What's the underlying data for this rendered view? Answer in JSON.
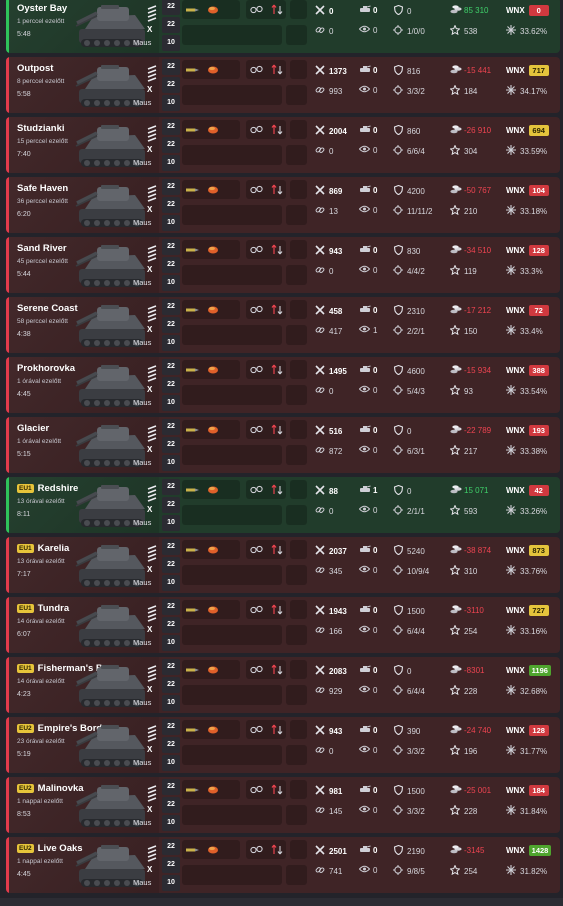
{
  "tank": {
    "name": "Maus",
    "x_label": "X"
  },
  "tiers": [
    "22",
    "22",
    "10"
  ],
  "colors": {
    "win_bg": "#213c2b",
    "loss_bg": "#3f2426",
    "win_accent": "#2fc25b",
    "loss_accent": "#e23b4c",
    "wnx_red": "#d0393f",
    "wnx_yellow": "#e4c43c",
    "wnx_green": "#4fa52e"
  },
  "icons": {
    "damage": "crossed-swords-icon",
    "frags": "tank-kill-icon",
    "block": "shield-icon",
    "assist": "link-icon",
    "spot": "eye-icon",
    "shots": "crosshair-icon",
    "credits": "coins-icon",
    "xp": "star-icon",
    "wn": "sparkle-icon"
  },
  "battles": [
    {
      "map": "Oyster Bay",
      "region": "",
      "ago": "1 perccel ezelőtt",
      "duration": "5:48",
      "result": "win",
      "damage": "0",
      "frags": "0",
      "blocked": "0",
      "assist": "0",
      "spotted": "0",
      "shots": "1/0/0",
      "credits": "85 310",
      "xp": "538",
      "wnx": "0",
      "wnx_color": "red",
      "wn_pct": "33.62%"
    },
    {
      "map": "Outpost",
      "region": "",
      "ago": "8 perccel ezelőtt",
      "duration": "5:58",
      "result": "loss",
      "damage": "1373",
      "frags": "0",
      "blocked": "816",
      "assist": "993",
      "spotted": "0",
      "shots": "3/3/2",
      "credits": "-15 441",
      "xp": "184",
      "wnx": "717",
      "wnx_color": "yellow",
      "wn_pct": "34.17%"
    },
    {
      "map": "Studzianki",
      "region": "",
      "ago": "15 perccel ezelőtt",
      "duration": "7:40",
      "result": "loss",
      "damage": "2004",
      "frags": "0",
      "blocked": "860",
      "assist": "0",
      "spotted": "0",
      "shots": "6/6/4",
      "credits": "-26 910",
      "xp": "304",
      "wnx": "694",
      "wnx_color": "yellow",
      "wn_pct": "33.59%"
    },
    {
      "map": "Safe Haven",
      "region": "",
      "ago": "36 perccel ezelőtt",
      "duration": "6:20",
      "result": "loss",
      "damage": "869",
      "frags": "0",
      "blocked": "4200",
      "assist": "13",
      "spotted": "0",
      "shots": "11/11/2",
      "credits": "-50 767",
      "xp": "210",
      "wnx": "104",
      "wnx_color": "red",
      "wn_pct": "33.18%"
    },
    {
      "map": "Sand River",
      "region": "",
      "ago": "45 perccel ezelőtt",
      "duration": "5:44",
      "result": "loss",
      "damage": "943",
      "frags": "0",
      "blocked": "830",
      "assist": "0",
      "spotted": "0",
      "shots": "4/4/2",
      "credits": "-34 510",
      "xp": "119",
      "wnx": "128",
      "wnx_color": "red",
      "wn_pct": "33.3%"
    },
    {
      "map": "Serene Coast",
      "region": "",
      "ago": "58 perccel ezelőtt",
      "duration": "4:38",
      "result": "loss",
      "damage": "458",
      "frags": "0",
      "blocked": "2310",
      "assist": "417",
      "spotted": "1",
      "shots": "2/2/1",
      "credits": "-17 212",
      "xp": "150",
      "wnx": "72",
      "wnx_color": "red",
      "wn_pct": "33.4%"
    },
    {
      "map": "Prokhorovka",
      "region": "",
      "ago": "1 órával ezelőtt",
      "duration": "4:45",
      "result": "loss",
      "damage": "1495",
      "frags": "0",
      "blocked": "4600",
      "assist": "0",
      "spotted": "0",
      "shots": "5/4/3",
      "credits": "-15 934",
      "xp": "93",
      "wnx": "388",
      "wnx_color": "red",
      "wn_pct": "33.54%"
    },
    {
      "map": "Glacier",
      "region": "",
      "ago": "1 órával ezelőtt",
      "duration": "5:15",
      "result": "loss",
      "damage": "516",
      "frags": "0",
      "blocked": "0",
      "assist": "872",
      "spotted": "0",
      "shots": "6/3/1",
      "credits": "-22 789",
      "xp": "217",
      "wnx": "193",
      "wnx_color": "red",
      "wn_pct": "33.38%"
    },
    {
      "map": "Redshire",
      "region": "EU1",
      "ago": "13 órával ezelőtt",
      "duration": "8:11",
      "result": "win",
      "damage": "88",
      "frags": "1",
      "blocked": "0",
      "assist": "0",
      "spotted": "0",
      "shots": "2/1/1",
      "credits": "15 071",
      "xp": "593",
      "wnx": "42",
      "wnx_color": "red",
      "wn_pct": "33.26%"
    },
    {
      "map": "Karelia",
      "region": "EU1",
      "ago": "13 órával ezelőtt",
      "duration": "7:17",
      "result": "loss",
      "damage": "2037",
      "frags": "0",
      "blocked": "5240",
      "assist": "345",
      "spotted": "0",
      "shots": "10/9/4",
      "credits": "-38 874",
      "xp": "310",
      "wnx": "873",
      "wnx_color": "yellow",
      "wn_pct": "33.76%"
    },
    {
      "map": "Tundra",
      "region": "EU1",
      "ago": "14 órával ezelőtt",
      "duration": "6:07",
      "result": "loss",
      "damage": "1943",
      "frags": "0",
      "blocked": "1500",
      "assist": "166",
      "spotted": "0",
      "shots": "6/4/4",
      "credits": "-3110",
      "xp": "254",
      "wnx": "727",
      "wnx_color": "yellow",
      "wn_pct": "33.16%"
    },
    {
      "map": "Fisherman's Bay",
      "region": "EU1",
      "ago": "14 órával ezelőtt",
      "duration": "4:23",
      "result": "loss",
      "damage": "2083",
      "frags": "0",
      "blocked": "0",
      "assist": "929",
      "spotted": "0",
      "shots": "6/4/4",
      "credits": "-8301",
      "xp": "228",
      "wnx": "1196",
      "wnx_color": "green",
      "wn_pct": "32.68%"
    },
    {
      "map": "Empire's Border",
      "region": "EU2",
      "ago": "23 órával ezelőtt",
      "duration": "5:19",
      "result": "loss",
      "damage": "943",
      "frags": "0",
      "blocked": "390",
      "assist": "0",
      "spotted": "0",
      "shots": "3/3/2",
      "credits": "-24 740",
      "xp": "196",
      "wnx": "128",
      "wnx_color": "red",
      "wn_pct": "31.77%"
    },
    {
      "map": "Malinovka",
      "region": "EU2",
      "ago": "1 nappal ezelőtt",
      "duration": "8:53",
      "result": "loss",
      "damage": "981",
      "frags": "0",
      "blocked": "1500",
      "assist": "145",
      "spotted": "0",
      "shots": "3/3/2",
      "credits": "-25 001",
      "xp": "228",
      "wnx": "184",
      "wnx_color": "red",
      "wn_pct": "31.84%"
    },
    {
      "map": "Live Oaks",
      "region": "EU2",
      "ago": "1 nappal ezelőtt",
      "duration": "4:45",
      "result": "loss",
      "damage": "2501",
      "frags": "0",
      "blocked": "2190",
      "assist": "741",
      "spotted": "0",
      "shots": "9/8/5",
      "credits": "-3145",
      "xp": "254",
      "wnx": "1428",
      "wnx_color": "green",
      "wn_pct": "31.82%"
    }
  ]
}
